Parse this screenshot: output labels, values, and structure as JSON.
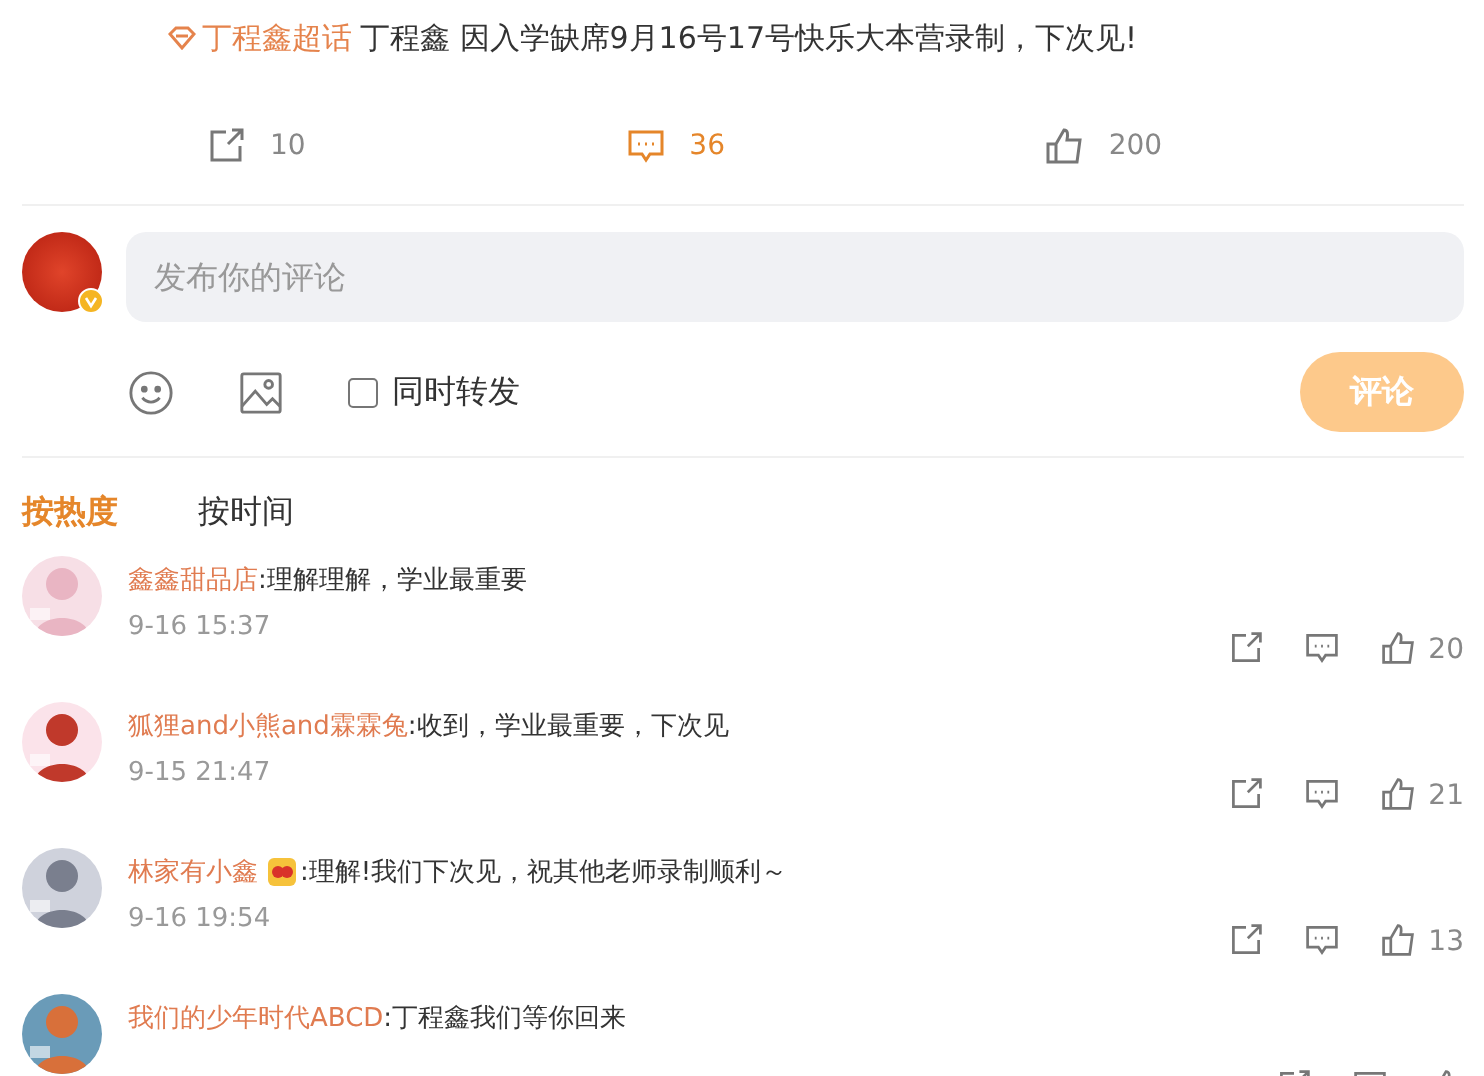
{
  "post": {
    "topic": "丁程鑫超话",
    "text": "丁程鑫 因入学缺席9月16号17号快乐大本营录制，下次见!",
    "actions": [
      {
        "kind": "share",
        "count": "10",
        "selected": false
      },
      {
        "kind": "comment",
        "count": "36",
        "selected": true
      },
      {
        "kind": "like",
        "count": "200",
        "selected": false
      }
    ]
  },
  "composer": {
    "placeholder": "发布你的评论",
    "repost_label": "同时转发",
    "repost_checked": false,
    "submit": "评论"
  },
  "sort_tabs": [
    {
      "label": "按热度",
      "selected": true
    },
    {
      "label": "按时间",
      "selected": false
    }
  ],
  "comments": [
    {
      "user": "鑫鑫甜品店",
      "text": ":理解理解，学业最重要",
      "time": "9-16 15:37",
      "likes": "20",
      "badge": false
    },
    {
      "user": "狐狸and小熊and霖霖兔",
      "text": ":收到，学业最重要，下次见",
      "time": "9-15 21:47",
      "likes": "21",
      "badge": false
    },
    {
      "user": "林家有小鑫",
      "text": ":理解!我们下次见，祝其他老师录制顺利～",
      "time": "9-16 19:54",
      "likes": "13",
      "badge": true
    },
    {
      "user": "我们的少年时代ABCD",
      "text": ":丁程鑫我们等你回来",
      "badge": false
    }
  ]
}
